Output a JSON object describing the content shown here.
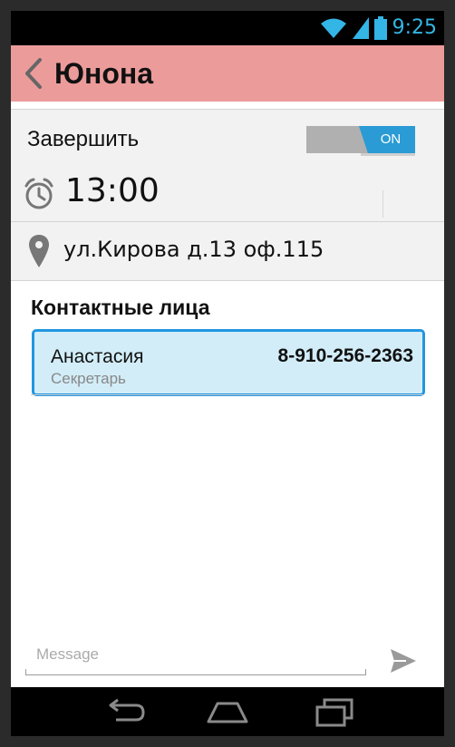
{
  "status": {
    "time": "9:25"
  },
  "appbar": {
    "title": "Юнона"
  },
  "finish": {
    "label": "Завершить",
    "toggle_state": "ON"
  },
  "time": {
    "value": "13:00"
  },
  "address": {
    "value": "ул.Кирова д.13 оф.115"
  },
  "contacts": {
    "section_title": "Контактные лица",
    "items": [
      {
        "name": "Анастасия",
        "role": "Секретарь",
        "phone": "8-910-256-2363"
      }
    ]
  },
  "message": {
    "placeholder": "Message",
    "value": ""
  },
  "colors": {
    "appbar": "#ec9b9b",
    "accent": "#2a9bd4",
    "status_accent": "#33b5e5",
    "card_bg": "#d2edf8"
  },
  "icons": [
    "wifi-icon",
    "signal-icon",
    "battery-icon",
    "back-icon",
    "alarm-icon",
    "location-pin-icon",
    "send-icon",
    "nav-back-icon",
    "nav-home-icon",
    "nav-recents-icon"
  ]
}
